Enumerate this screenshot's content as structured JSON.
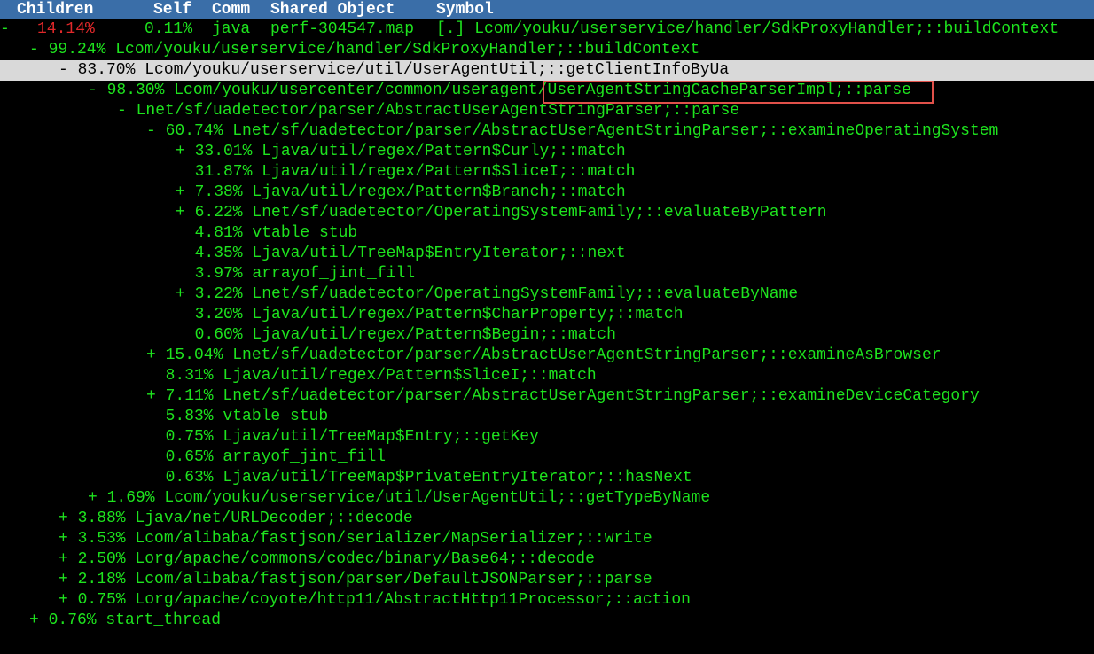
{
  "header": {
    "children": "Children",
    "self": "Self",
    "comm": "Comm",
    "shared_object": "Shared Object",
    "symbol": "Symbol"
  },
  "top_row": {
    "marker": "-",
    "children": "14.14%",
    "self": "0.11%",
    "comm": "java",
    "shared_object": "perf-304547.map",
    "symbol": "[.] Lcom/youku/userservice/handler/SdkProxyHandler;::buildContext"
  },
  "tree_rows": [
    {
      "indent": 2,
      "text": "- 99.24% Lcom/youku/userservice/handler/SdkProxyHandler;::buildContext",
      "selected": false
    },
    {
      "indent": 4,
      "text": "- 83.70% Lcom/youku/userservice/util/UserAgentUtil;::getClientInfoByUa",
      "selected": true
    },
    {
      "indent": 6,
      "text": "- 98.30% Lcom/youku/usercenter/common/useragent/UserAgentStringCacheParserImpl;::parse",
      "selected": false
    },
    {
      "indent": 8,
      "text": "- Lnet/sf/uadetector/parser/AbstractUserAgentStringParser;::parse",
      "selected": false
    },
    {
      "indent": 10,
      "text": "- 60.74% Lnet/sf/uadetector/parser/AbstractUserAgentStringParser;::examineOperatingSystem",
      "selected": false
    },
    {
      "indent": 12,
      "text": "+ 33.01% Ljava/util/regex/Pattern$Curly;::match",
      "selected": false
    },
    {
      "indent": 12,
      "text": "  31.87% Ljava/util/regex/Pattern$SliceI;::match",
      "selected": false
    },
    {
      "indent": 12,
      "text": "+ 7.38% Ljava/util/regex/Pattern$Branch;::match",
      "selected": false
    },
    {
      "indent": 12,
      "text": "+ 6.22% Lnet/sf/uadetector/OperatingSystemFamily;::evaluateByPattern",
      "selected": false
    },
    {
      "indent": 12,
      "text": "  4.81% vtable stub",
      "selected": false
    },
    {
      "indent": 12,
      "text": "  4.35% Ljava/util/TreeMap$EntryIterator;::next",
      "selected": false
    },
    {
      "indent": 12,
      "text": "  3.97% arrayof_jint_fill",
      "selected": false
    },
    {
      "indent": 12,
      "text": "+ 3.22% Lnet/sf/uadetector/OperatingSystemFamily;::evaluateByName",
      "selected": false
    },
    {
      "indent": 12,
      "text": "  3.20% Ljava/util/regex/Pattern$CharProperty;::match",
      "selected": false
    },
    {
      "indent": 12,
      "text": "  0.60% Ljava/util/regex/Pattern$Begin;::match",
      "selected": false
    },
    {
      "indent": 10,
      "text": "+ 15.04% Lnet/sf/uadetector/parser/AbstractUserAgentStringParser;::examineAsBrowser",
      "selected": false
    },
    {
      "indent": 10,
      "text": "  8.31% Ljava/util/regex/Pattern$SliceI;::match",
      "selected": false
    },
    {
      "indent": 10,
      "text": "+ 7.11% Lnet/sf/uadetector/parser/AbstractUserAgentStringParser;::examineDeviceCategory",
      "selected": false
    },
    {
      "indent": 10,
      "text": "  5.83% vtable stub",
      "selected": false
    },
    {
      "indent": 10,
      "text": "  0.75% Ljava/util/TreeMap$Entry;::getKey",
      "selected": false
    },
    {
      "indent": 10,
      "text": "  0.65% arrayof_jint_fill",
      "selected": false
    },
    {
      "indent": 10,
      "text": "  0.63% Ljava/util/TreeMap$PrivateEntryIterator;::hasNext",
      "selected": false
    },
    {
      "indent": 6,
      "text": "+ 1.69% Lcom/youku/userservice/util/UserAgentUtil;::getTypeByName",
      "selected": false
    },
    {
      "indent": 4,
      "text": "+ 3.88% Ljava/net/URLDecoder;::decode",
      "selected": false
    },
    {
      "indent": 4,
      "text": "+ 3.53% Lcom/alibaba/fastjson/serializer/MapSerializer;::write",
      "selected": false
    },
    {
      "indent": 4,
      "text": "+ 2.50% Lorg/apache/commons/codec/binary/Base64;::decode",
      "selected": false
    },
    {
      "indent": 4,
      "text": "+ 2.18% Lcom/alibaba/fastjson/parser/DefaultJSONParser;::parse",
      "selected": false
    },
    {
      "indent": 4,
      "text": "+ 0.75% Lorg/apache/coyote/http11/AbstractHttp11Processor;::action",
      "selected": false
    },
    {
      "indent": 2,
      "text": "+ 0.76% start_thread",
      "selected": false
    }
  ],
  "colors": {
    "header_bg": "#3a6ea8",
    "text_green": "#1ee31e",
    "children_red": "#e0282a",
    "selected_bg": "#d9d9d9",
    "highlight_border": "#e0514a"
  }
}
